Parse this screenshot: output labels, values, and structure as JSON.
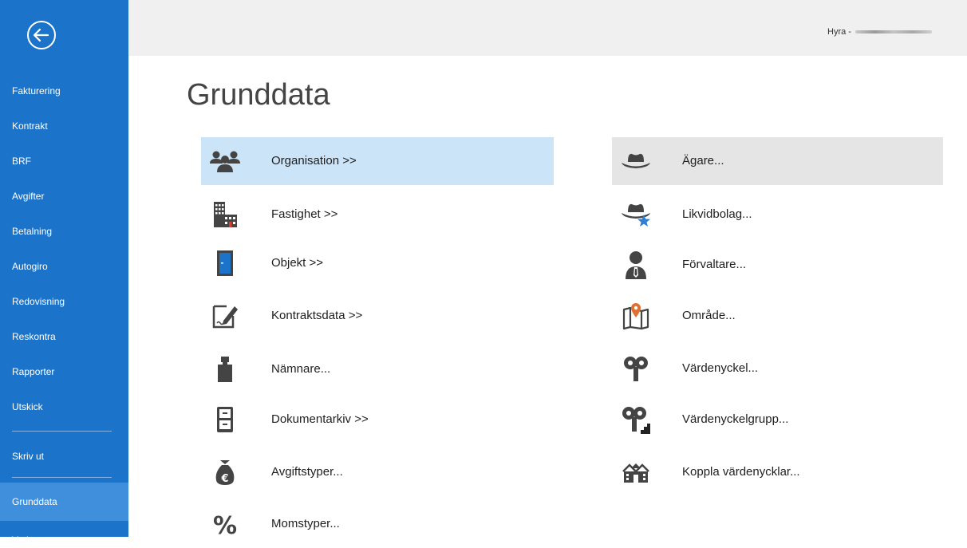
{
  "topbar": {
    "window_title": "Hyra - "
  },
  "main": {
    "title": "Grunddata"
  },
  "sidebar": {
    "items": [
      {
        "label": "Fakturering"
      },
      {
        "label": "Kontrakt"
      },
      {
        "label": "BRF"
      },
      {
        "label": "Avgifter"
      },
      {
        "label": "Betalning"
      },
      {
        "label": "Autogiro"
      },
      {
        "label": "Redovisning"
      },
      {
        "label": "Reskontra"
      },
      {
        "label": "Rapporter"
      },
      {
        "label": "Utskick"
      },
      {
        "label": "Skriv ut"
      },
      {
        "label": "Grunddata"
      },
      {
        "label": "Verktyg"
      }
    ]
  },
  "tiles_left": [
    {
      "label": "Organisation >>",
      "icon": "people-group-icon"
    },
    {
      "label": "Fastighet >>",
      "icon": "building-icon"
    },
    {
      "label": "Objekt >>",
      "icon": "door-icon"
    },
    {
      "label": "Kontraktsdata >>",
      "icon": "signed-document-icon"
    },
    {
      "label": "Nämnare...",
      "icon": "weight-icon"
    },
    {
      "label": "Dokumentarkiv >>",
      "icon": "file-cabinet-icon"
    },
    {
      "label": "Avgiftstyper...",
      "icon": "money-bag-euro-icon"
    },
    {
      "label": "Momstyper...",
      "icon": "percent-icon"
    }
  ],
  "tiles_right": [
    {
      "label": "Ägare...",
      "icon": "hat-icon"
    },
    {
      "label": "Likvidbolag...",
      "icon": "hat-star-icon"
    },
    {
      "label": "Förvaltare...",
      "icon": "person-tie-icon"
    },
    {
      "label": "Område...",
      "icon": "map-pin-icon"
    },
    {
      "label": "Värdenyckel...",
      "icon": "key-icon"
    },
    {
      "label": "Värdenyckelgrupp...",
      "icon": "key-group-icon"
    },
    {
      "label": "Koppla värdenycklar...",
      "icon": "houses-link-icon"
    }
  ],
  "colors": {
    "sidebar": "#1b74c9",
    "sidebar_active": "#3f8fdc",
    "selected_tile": "#cce4f7",
    "hover_tile": "#e5e5e5",
    "icon_gray": "#444444",
    "accent_blue": "#1b74c9",
    "accent_orange": "#e07030"
  }
}
